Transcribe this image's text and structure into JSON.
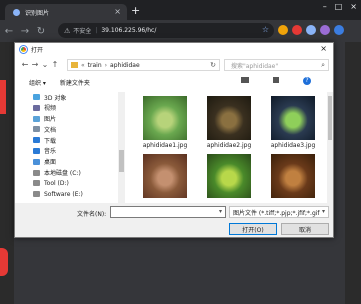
{
  "browser": {
    "tab_title": "识别图片",
    "tab_close": "×",
    "new_tab": "+",
    "window_controls": [
      "–",
      "□",
      "×"
    ],
    "security_label": "不安全",
    "url": "39.106.225.96/hc/",
    "nav": {
      "back": "←",
      "forward": "→",
      "reload": "↻"
    },
    "star": "☆",
    "extension_colors": [
      "#f0a30a",
      "#e53935",
      "#8ab4f8",
      "#9b6dd6",
      "#3b7de0"
    ]
  },
  "dialog": {
    "title": "打开",
    "close": "×",
    "path": [
      "train",
      "aphididae"
    ],
    "search_placeholder": "搜索\"aphididae\"",
    "commands": {
      "organize": "组织 ▾",
      "new_folder": "新建文件夹"
    },
    "help": "?",
    "nav_items": [
      {
        "label": "3D 对象",
        "icon": "3d-objects-icon",
        "color": "#4aa3df"
      },
      {
        "label": "视频",
        "icon": "videos-icon",
        "color": "#6b6b9e"
      },
      {
        "label": "图片",
        "icon": "pictures-icon",
        "color": "#5aa2d8"
      },
      {
        "label": "文档",
        "icon": "documents-icon",
        "color": "#7d8fa3"
      },
      {
        "label": "下载",
        "icon": "downloads-icon",
        "color": "#2a7ad6"
      },
      {
        "label": "音乐",
        "icon": "music-icon",
        "color": "#2a7ad6"
      },
      {
        "label": "桌面",
        "icon": "desktop-icon",
        "color": "#4a90d9"
      },
      {
        "label": "本地磁盘 (C:)",
        "icon": "drive-c-icon",
        "color": "#8a8a8a"
      },
      {
        "label": "Tool  (D:)",
        "icon": "drive-d-icon",
        "color": "#8a8a8a"
      },
      {
        "label": "Software (E:)",
        "icon": "drive-e-icon",
        "color": "#8a8a8a"
      }
    ],
    "files": [
      {
        "name": "aphididae1.jpg",
        "colors": [
          "#6aa84f",
          "#b7d37a",
          "#3b6a2a"
        ]
      },
      {
        "name": "aphididae2.jpg",
        "colors": [
          "#3a3020",
          "#8a7040",
          "#1e1a10"
        ]
      },
      {
        "name": "aphididae3.jpg",
        "colors": [
          "#2a3a50",
          "#8fcf5a",
          "#0f1a28"
        ]
      },
      {
        "name": "",
        "colors": [
          "#8a5a3a",
          "#c49070",
          "#5a3020"
        ]
      },
      {
        "name": "",
        "colors": [
          "#4a8a2a",
          "#b8d84a",
          "#2a4a1a"
        ]
      },
      {
        "name": "",
        "colors": [
          "#6a3a1a",
          "#c08040",
          "#3a200a"
        ]
      }
    ],
    "filename_label": "文件名(N):",
    "filename_value": "",
    "filetype": "图片文件 (*.tiff;*.pjp;*.jfif;*.gif",
    "dropdown": "▾",
    "open_button": "打开(O)",
    "cancel_button": "取消"
  }
}
